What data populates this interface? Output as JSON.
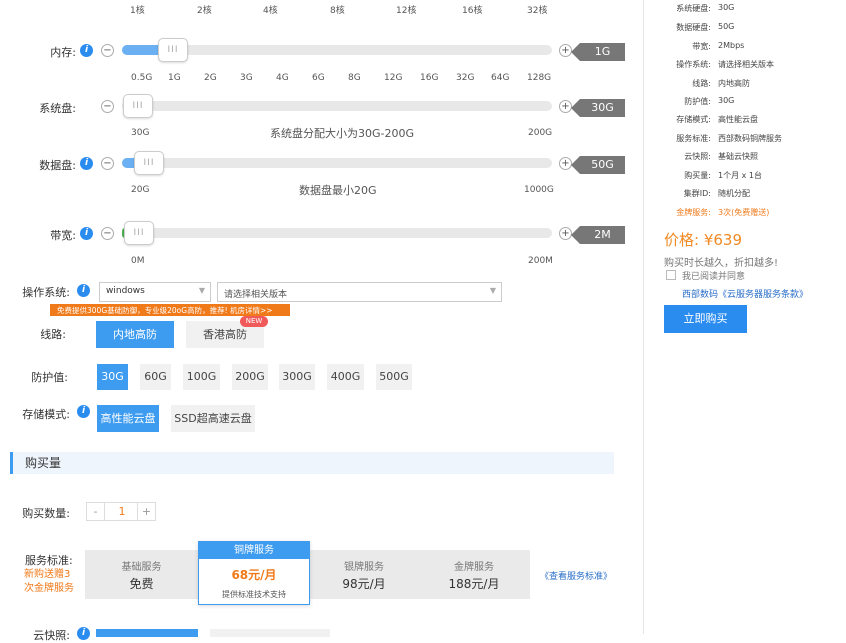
{
  "cpu": {
    "ticks": [
      "1核",
      "2核",
      "4核",
      "8核",
      "12核",
      "16核",
      "32核"
    ]
  },
  "memory": {
    "label": "内存:",
    "value": "1G",
    "fill": 0.1,
    "ticks": [
      "0.5G",
      "1G",
      "2G",
      "3G",
      "4G",
      "6G",
      "8G",
      "12G",
      "16G",
      "32G",
      "64G",
      "128G"
    ]
  },
  "system_disk": {
    "label": "系统盘:",
    "value": "30G",
    "min": "30G",
    "max": "200G",
    "note": "系统盘分配大小为30G-200G"
  },
  "data_disk": {
    "label": "数据盘:",
    "value": "50G",
    "min": "20G",
    "max": "1000G",
    "note": "数据盘最小20G"
  },
  "bandwidth": {
    "label": "带宽:",
    "value": "2M",
    "min": "0M",
    "max": "200M"
  },
  "handle_glyph": "III",
  "os": {
    "label": "操作系统:",
    "selected": "windows",
    "version_placeholder": "请选择相关版本",
    "promo": "免费提供300G基础防御，专业级20oG高防，推荐! 机房详情>>"
  },
  "line": {
    "label": "线路:",
    "options": [
      "内地高防",
      "香港高防"
    ],
    "new_badge": "NEW"
  },
  "protection": {
    "label": "防护值:",
    "options": [
      "30G",
      "60G",
      "100G",
      "200G",
      "300G",
      "400G",
      "500G"
    ]
  },
  "storage": {
    "label": "存储模式:",
    "options": [
      "高性能云盘",
      "SSD超高速云盘"
    ]
  },
  "purchase": {
    "section_title": "购买量",
    "qty_label": "购买数量:",
    "minus": "-",
    "qty": "1",
    "plus": "+",
    "service_label": "服务标准:",
    "service_promo_1": "新购送赠3",
    "service_promo_2": "次金牌服务",
    "services": [
      {
        "name": "基础服务",
        "price": "免费"
      },
      {
        "name": "铜牌服务",
        "price": "68元/月",
        "note": "提供标准技术支持"
      },
      {
        "name": "银牌服务",
        "price": "98元/月"
      },
      {
        "name": "金牌服务",
        "price": "188元/月"
      }
    ],
    "view_standard": "《查看服务标准》",
    "cut_label": "云快照:"
  },
  "summary": {
    "rows": [
      {
        "k": "系统硬盘:",
        "v": "30G"
      },
      {
        "k": "数据硬盘:",
        "v": "50G"
      },
      {
        "k": "带宽:",
        "v": "2Mbps"
      },
      {
        "k": "操作系统:",
        "v": "请选择相关版本"
      },
      {
        "k": "线路:",
        "v": "内地高防"
      },
      {
        "k": "防护值:",
        "v": "30G"
      },
      {
        "k": "存储模式:",
        "v": "高性能云盘"
      },
      {
        "k": "服务标准:",
        "v": "西部数码铜牌服务"
      },
      {
        "k": "云快照:",
        "v": "基础云快照"
      },
      {
        "k": "购买量:",
        "v": "1个月 x 1台"
      },
      {
        "k": "集群ID:",
        "v": "随机分配"
      }
    ],
    "gold_k": "金牌服务:",
    "gold_v": "3次(免费赠送)",
    "price_label": "价格: ¥639",
    "slogan": "购买时长越久，折扣越多!",
    "agree": "我已阅读并同意",
    "terms": "西部数码《云服务器服务条款》",
    "buy": "立即购买"
  },
  "colors": {
    "accent": "#3d9bf0",
    "orange": "#f07a1a",
    "price": "#f08a24"
  }
}
